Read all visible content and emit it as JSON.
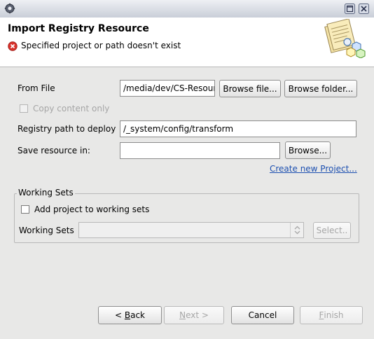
{
  "header": {
    "title": "Import Registry Resource",
    "error_message": "Specified project or path doesn't exist"
  },
  "form": {
    "from_file_label": "From File",
    "from_file_value": "/media/dev/CS-Resour",
    "browse_file_label": "Browse file...",
    "browse_folder_label": "Browse folder...",
    "copy_content_label": "Copy content only",
    "registry_path_label": "Registry path to deploy",
    "registry_path_value": "/_system/config/transform",
    "save_resource_label": "Save resource in:",
    "save_resource_value": "",
    "browse_label": "Browse...",
    "create_project_link": "Create new Project..."
  },
  "working_sets": {
    "group_title": "Working Sets",
    "add_project_label": "Add project to working sets",
    "working_sets_label": "Working Sets",
    "working_sets_value": "",
    "select_label": "Select.."
  },
  "footer": {
    "back_prefix": "< ",
    "back_mnemonic": "B",
    "back_rest": "ack",
    "next_mnemonic": "N",
    "next_rest": "ext >",
    "cancel_label": "Cancel",
    "finish_mnemonic": "F",
    "finish_rest": "inish"
  },
  "colors": {
    "error_icon": "#d9312b",
    "link": "#1c4fb0"
  }
}
